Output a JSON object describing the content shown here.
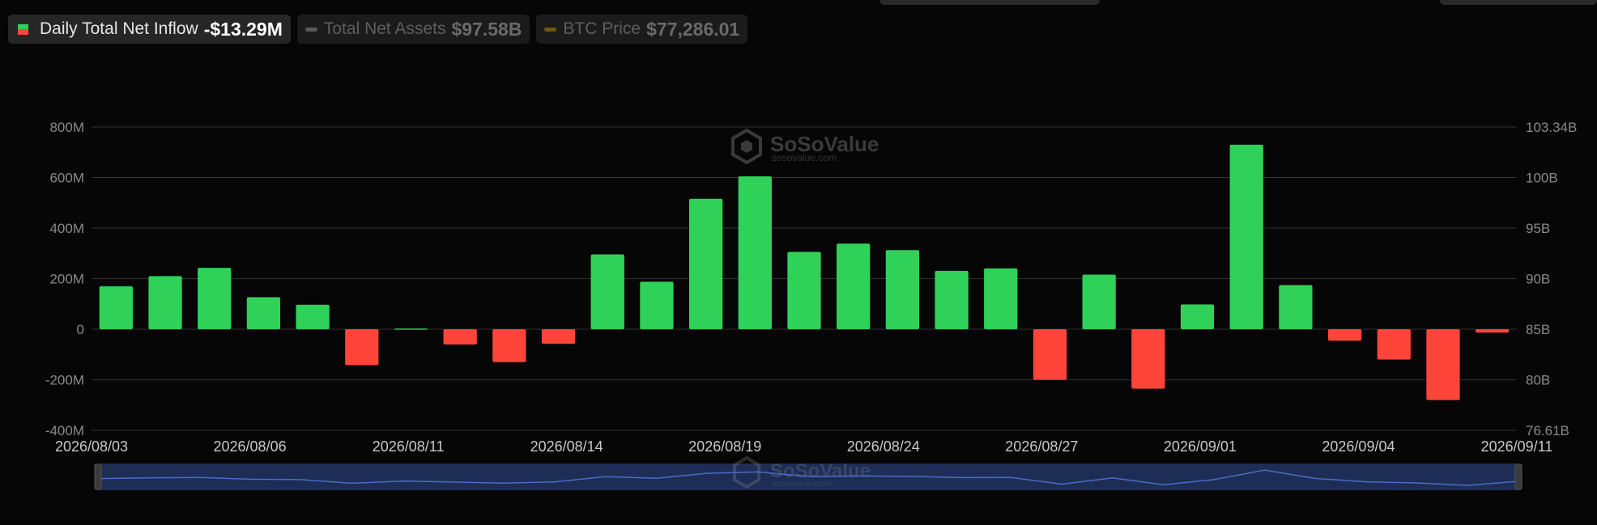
{
  "legend": {
    "inflow": {
      "label": "Daily Total Net Inflow",
      "value": "-$13.29M",
      "color_pos": "#30d158",
      "color_neg": "#ff453a"
    },
    "assets": {
      "label": "Total Net Assets",
      "value": "$97.58B",
      "color": "#5a5a5a"
    },
    "btc": {
      "label": "BTC Price",
      "value": "$77,286.01",
      "color": "#6b5a12"
    }
  },
  "watermark": {
    "name": "SoSoValue",
    "url": "sosovalue.com"
  },
  "colors": {
    "positive": "#30d158",
    "negative": "#ff453a",
    "grid": "#333333",
    "axis_text": "#8a8a8a",
    "navigator": "#1d2d55",
    "navigator_line": "#4a6cc4"
  },
  "chart_data": {
    "type": "bar",
    "title": "",
    "xlabel": "",
    "ylabel": "",
    "ylim": [
      -400,
      800
    ],
    "y_unit": "M",
    "left_ticks": [
      "800M",
      "600M",
      "400M",
      "200M",
      "0",
      "-200M",
      "-400M"
    ],
    "right_ticks": [
      "103.34B",
      "100B",
      "95B",
      "90B",
      "85B",
      "80B",
      "76.61B"
    ],
    "right_ylim": [
      76.61,
      103.34
    ],
    "x_tick_labels": [
      "2026/08/03",
      "2026/08/06",
      "2026/08/11",
      "2026/08/14",
      "2026/08/19",
      "2026/08/24",
      "2026/08/27",
      "2026/09/01",
      "2026/09/04",
      "2026/09/11"
    ],
    "grid": true,
    "series": [
      {
        "name": "Daily Total Net Inflow",
        "values": [
          170,
          210,
          243,
          127,
          97,
          -142,
          3,
          -60,
          -130,
          -57,
          296,
          188,
          516,
          605,
          306,
          339,
          313,
          231,
          241,
          -200,
          216,
          -235,
          98,
          730,
          175,
          -45,
          -120,
          -280,
          -13.29
        ]
      }
    ]
  }
}
